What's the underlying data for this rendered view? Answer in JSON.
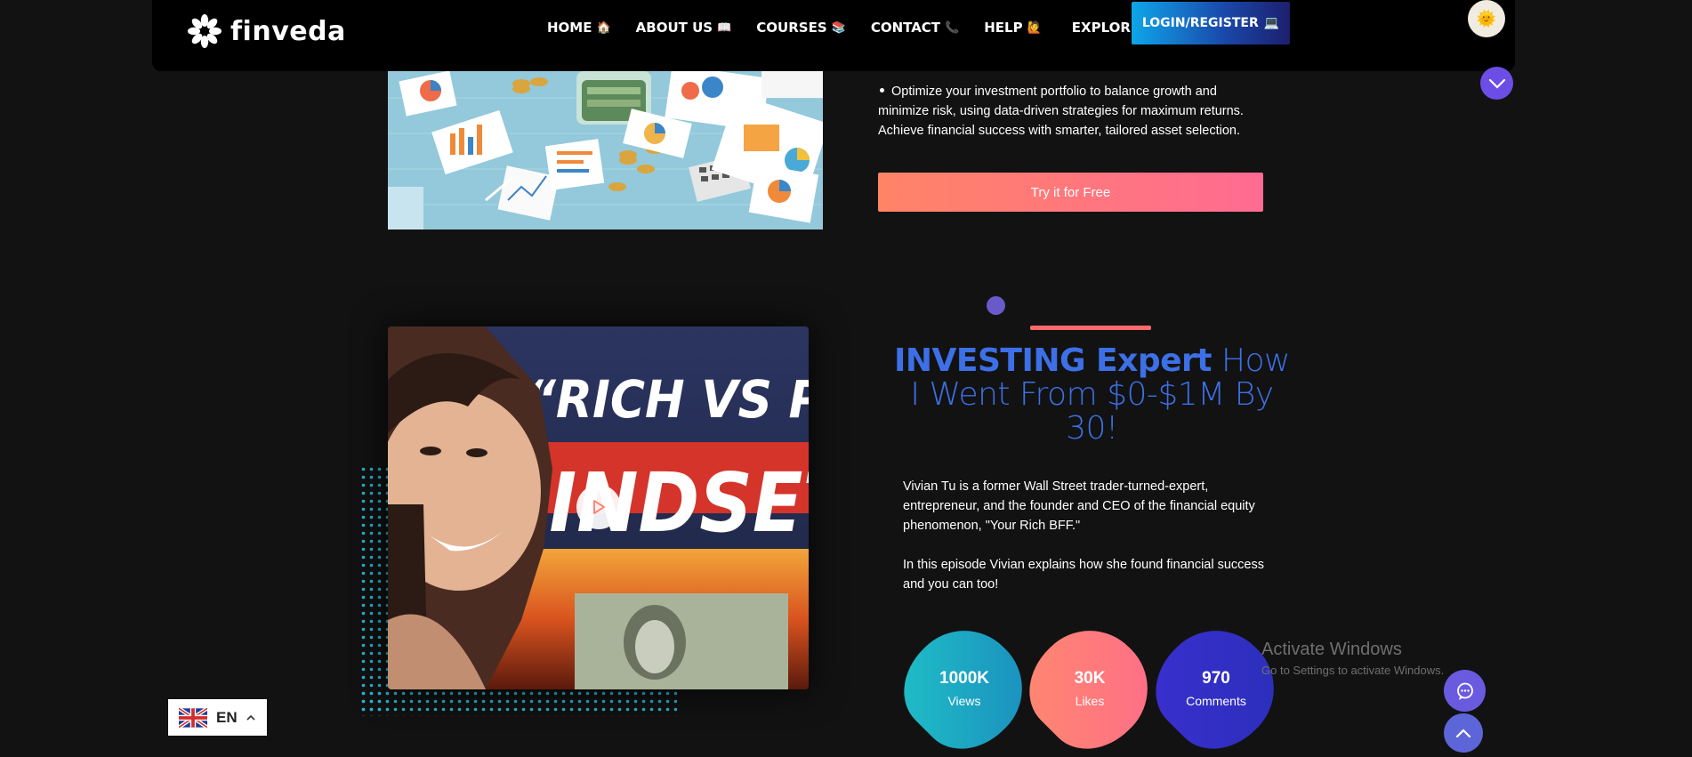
{
  "nav": {
    "logo_text": "finveda",
    "items": [
      {
        "label": "HOME",
        "emoji": "🏠"
      },
      {
        "label": "ABOUT US",
        "emoji": "📖"
      },
      {
        "label": "COURSES",
        "emoji": "📚"
      },
      {
        "label": "CONTACT",
        "emoji": "📞"
      },
      {
        "label": "HELP",
        "emoji": "🙋"
      },
      {
        "label": "EXPLORE",
        "emoji": "📚"
      }
    ],
    "login_label": "LOGIN/REGISTER",
    "login_emoji": "💻",
    "avatar_emoji": "🌞"
  },
  "top_section": {
    "bullet_text": "Optimize your investment portfolio to balance growth and minimize risk, using data-driven strategies for maximum returns. Achieve financial success with smarter, tailored asset selection.",
    "cta_label": "Try it for Free"
  },
  "video_section": {
    "thumb_line1": "“RICH VS POOR",
    "thumb_line2": "MINDSET”",
    "headline_strong": "INVESTING Expert",
    "headline_light": " How I Went From $0-$1M By 30!",
    "desc_p1": "Vivian Tu is a former Wall Street trader-turned-expert, entrepreneur, and the founder and CEO of the financial equity phenomenon, \"Your Rich BFF.\"",
    "desc_p2": "In this episode Vivian explains how she found financial success and you can too!",
    "stats": [
      {
        "value": "1000K",
        "label": "Views"
      },
      {
        "value": "30K",
        "label": "Likes"
      },
      {
        "value": "970",
        "label": "Comments"
      }
    ]
  },
  "watermark": {
    "title": "Activate Windows",
    "subtitle": "Go to Settings to activate Windows."
  },
  "language": {
    "code": "EN"
  },
  "colors": {
    "accent_blue": "#3d70e6",
    "cta_pink": "#ff6b92",
    "stat_teal": "#1aa7c2",
    "stat_salmon": "#ff7a7a",
    "stat_indigo": "#2f2fc9"
  }
}
